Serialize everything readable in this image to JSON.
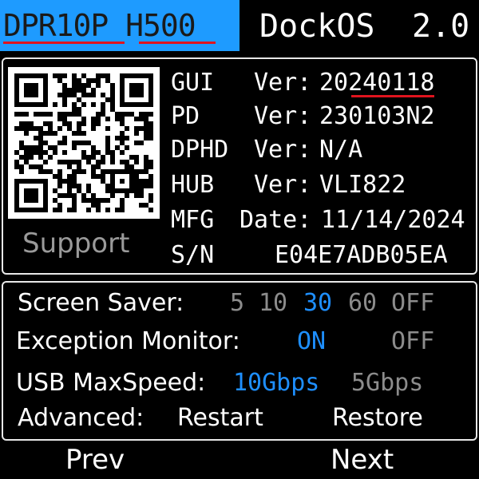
{
  "header": {
    "model_part1": "DPR10P",
    "model_part2": "H500",
    "os_name": "DockOS",
    "os_version": "2.0",
    "accent_color": "#1e9bff",
    "underline_color": "#e0141e"
  },
  "info": {
    "qr_icon": "qr-code-icon",
    "support_label": "Support",
    "rows": [
      {
        "name": "GUI",
        "label": "Ver:",
        "value": "20240118"
      },
      {
        "name": "PD",
        "label": "Ver:",
        "value": "230103N2"
      },
      {
        "name": "DPHD",
        "label": "Ver:",
        "value": "N/A"
      },
      {
        "name": "HUB",
        "label": "Ver:",
        "value": "VLI822"
      },
      {
        "name": "MFG",
        "label": "Date:",
        "value": "11/14/2024"
      },
      {
        "name": "S/N",
        "label": "",
        "value": "E04E7ADB05EA"
      }
    ]
  },
  "settings": {
    "screen_saver": {
      "label": "Screen Saver:",
      "options": [
        "5",
        "10",
        "30",
        "60",
        "OFF"
      ],
      "selected": "30"
    },
    "exception_monitor": {
      "label": "Exception Monitor:",
      "options": [
        "ON",
        "OFF"
      ],
      "selected": "ON"
    },
    "usb_max_speed": {
      "label": "USB MaxSpeed:",
      "options": [
        "10Gbps",
        "5Gbps"
      ],
      "selected": "10Gbps"
    },
    "advanced": {
      "label": "Advanced:",
      "restart": "Restart",
      "restore": "Restore"
    },
    "selected_color": "#1e8fff"
  },
  "footer": {
    "prev": "Prev",
    "next": "Next"
  }
}
